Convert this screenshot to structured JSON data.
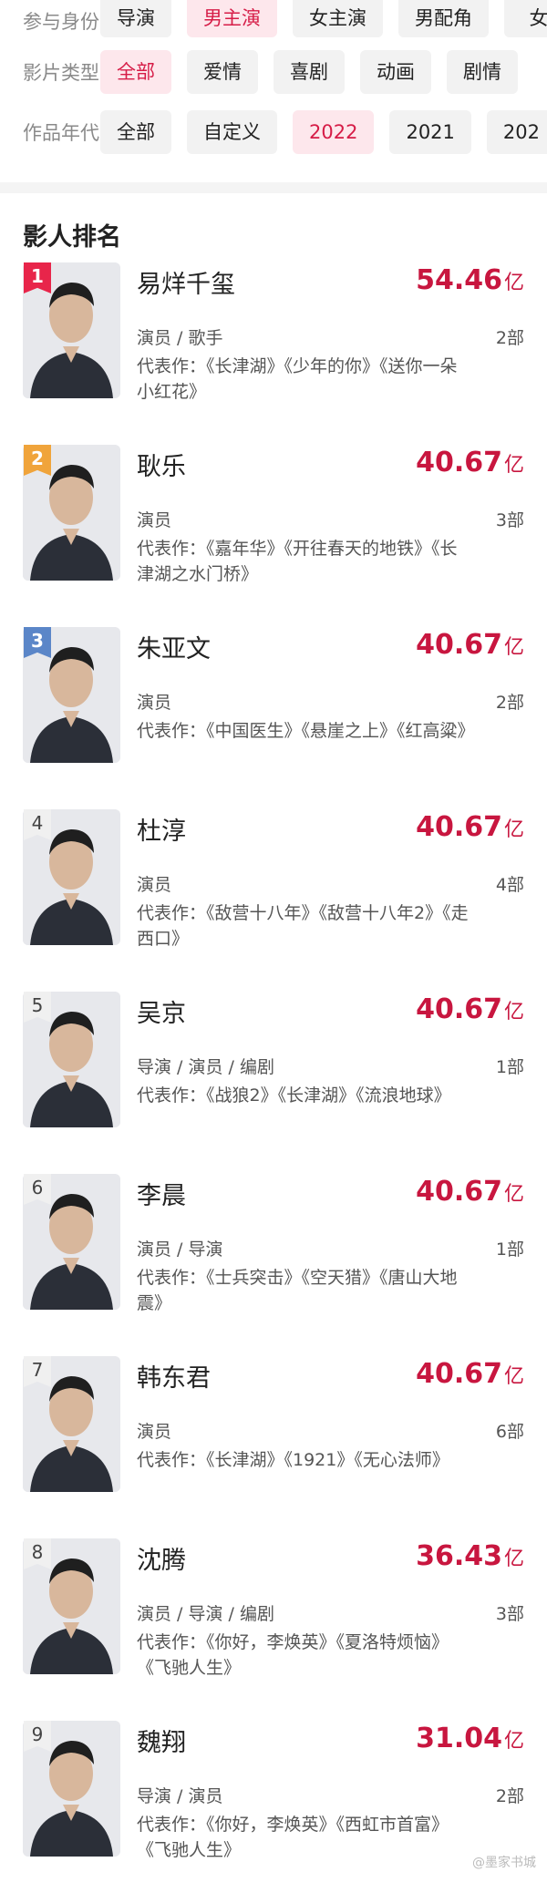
{
  "filters": {
    "participation": {
      "label": "参与身份",
      "options": [
        "导演",
        "男主演",
        "女主演",
        "男配角",
        "女"
      ],
      "active_index": 1
    },
    "genre": {
      "label": "影片类型",
      "options": [
        "全部",
        "爱情",
        "喜剧",
        "动画",
        "剧情"
      ],
      "active_index": 0
    },
    "year": {
      "label": "作品年代",
      "options": [
        "全部",
        "自定义",
        "2022",
        "2021",
        "202"
      ],
      "active_index": 2
    }
  },
  "ranking": {
    "title": "影人排名",
    "items": [
      {
        "rank": "1",
        "name": "易烊千玺",
        "box_office": "54.46",
        "unit": "亿",
        "roles": "演员 / 歌手",
        "works_count": "2部",
        "works": "代表作：《长津湖》《少年的你》《送你一朵小红花》"
      },
      {
        "rank": "2",
        "name": "耿乐",
        "box_office": "40.67",
        "unit": "亿",
        "roles": "演员",
        "works_count": "3部",
        "works": "代表作：《嘉年华》《开往春天的地铁》《长津湖之水门桥》"
      },
      {
        "rank": "3",
        "name": "朱亚文",
        "box_office": "40.67",
        "unit": "亿",
        "roles": "演员",
        "works_count": "2部",
        "works": "代表作：《中国医生》《悬崖之上》《红高粱》"
      },
      {
        "rank": "4",
        "name": "杜淳",
        "box_office": "40.67",
        "unit": "亿",
        "roles": "演员",
        "works_count": "4部",
        "works": "代表作：《敌营十八年》《敌营十八年2》《走西口》"
      },
      {
        "rank": "5",
        "name": "吴京",
        "box_office": "40.67",
        "unit": "亿",
        "roles": "导演 / 演员 / 编剧",
        "works_count": "1部",
        "works": "代表作：《战狼2》《长津湖》《流浪地球》"
      },
      {
        "rank": "6",
        "name": "李晨",
        "box_office": "40.67",
        "unit": "亿",
        "roles": "演员 / 导演",
        "works_count": "1部",
        "works": "代表作：《士兵突击》《空天猎》《唐山大地震》"
      },
      {
        "rank": "7",
        "name": "韩东君",
        "box_office": "40.67",
        "unit": "亿",
        "roles": "演员",
        "works_count": "6部",
        "works": "代表作：《长津湖》《1921》《无心法师》"
      },
      {
        "rank": "8",
        "name": "沈腾",
        "box_office": "36.43",
        "unit": "亿",
        "roles": "演员 / 导演 / 编剧",
        "works_count": "3部",
        "works": "代表作：《你好，李焕英》《夏洛特烦恼》《飞驰人生》"
      },
      {
        "rank": "9",
        "name": "魏翔",
        "box_office": "31.04",
        "unit": "亿",
        "roles": "导演 / 演员",
        "works_count": "2部",
        "works": "代表作：《你好，李焕英》《西虹市首富》《飞驰人生》"
      }
    ]
  },
  "watermark": "@墨家书城",
  "colors": {
    "accent": "#c8163f",
    "chip_active_bg": "#fde7ec",
    "chip_active_text": "#d61c47",
    "badge_gold": "#e8254a",
    "badge_silver": "#f0a43b",
    "badge_bronze": "#5b86c8"
  }
}
